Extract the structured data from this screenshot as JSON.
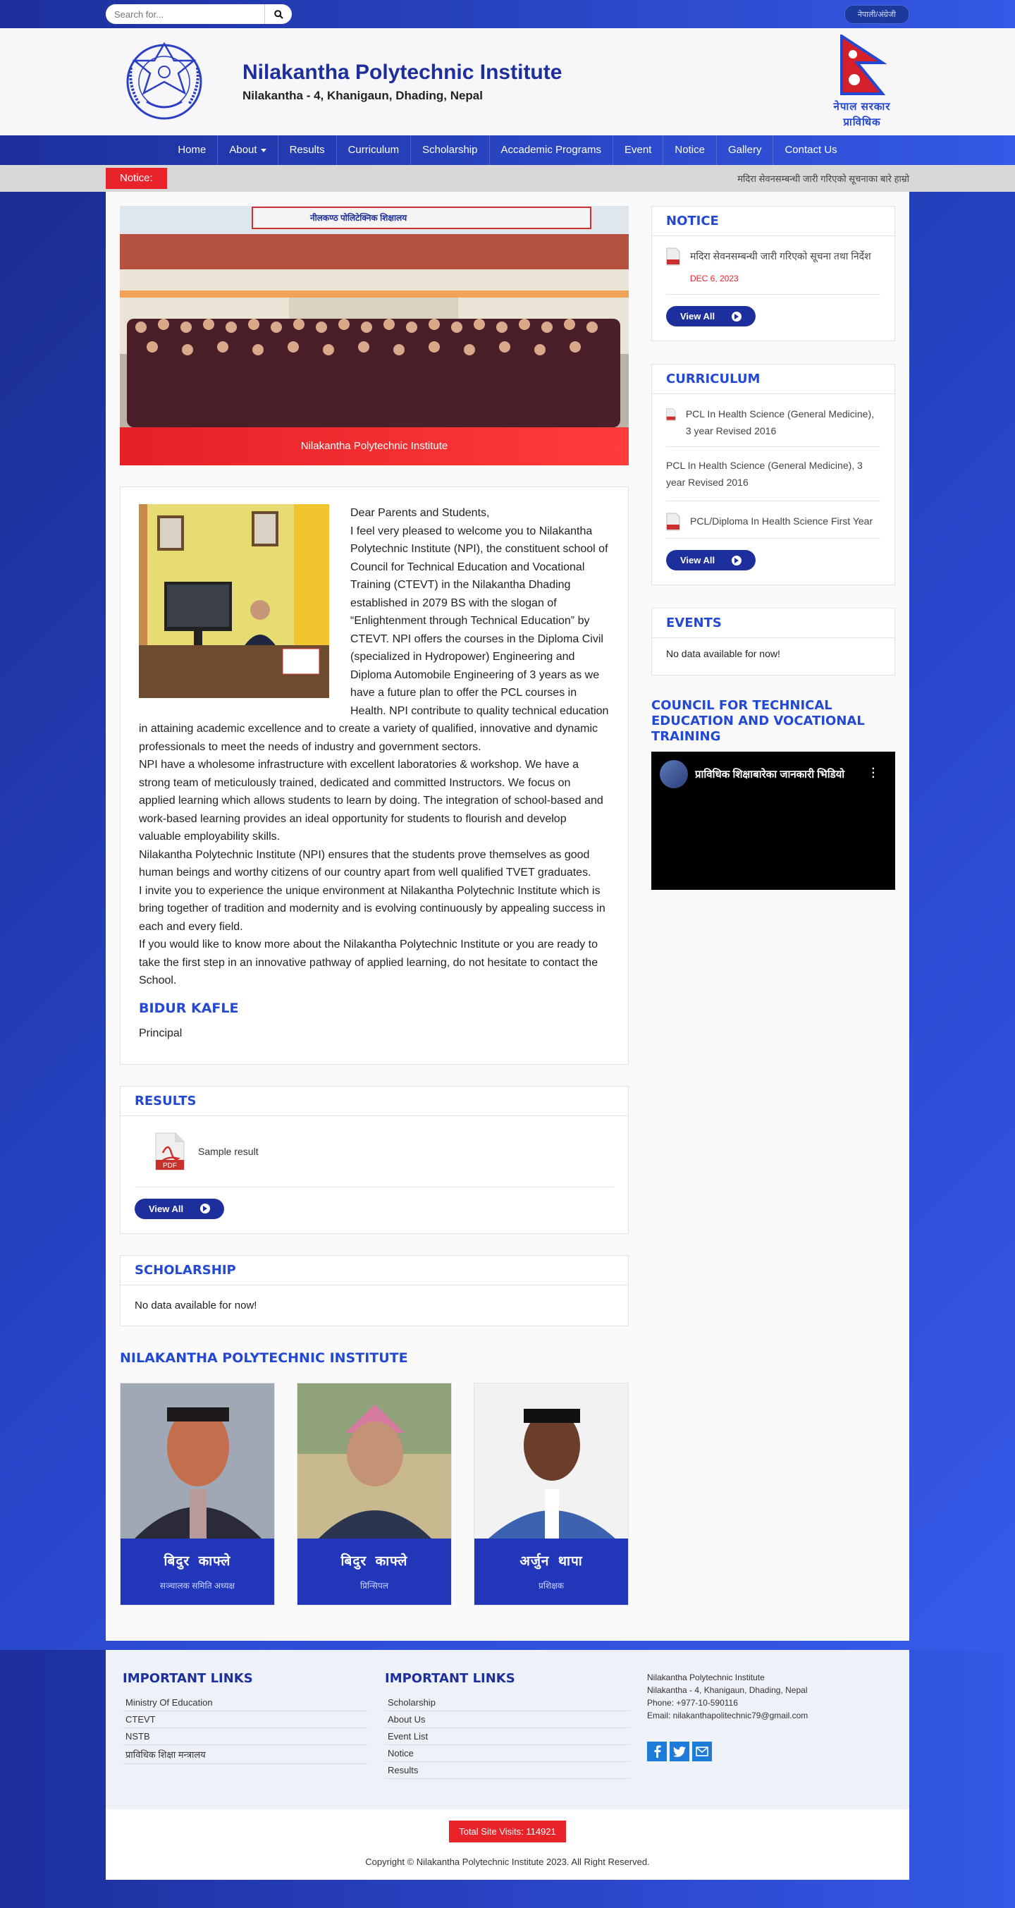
{
  "topbar": {
    "search_placeholder": "Search for...",
    "lang_label": "नेपाली/अंग्रेजी"
  },
  "header": {
    "title": "Nilakantha Polytechnic Institute",
    "subtitle": "Nilakantha - 4, Khanigaun, Dhading, Nepal",
    "flag_caption_1": "नेपाल सरकार",
    "flag_caption_2": "प्राविधिक"
  },
  "nav": {
    "items": [
      "Home",
      "About",
      "Results",
      "Curriculum",
      "Scholarship",
      "Accademic Programs",
      "Event",
      "Notice",
      "Gallery",
      "Contact Us"
    ]
  },
  "ticker": {
    "label": "Notice:",
    "text": "मदिरा सेवनसम्बन्धी जारी गरिएको सूचनाका बारे हाम्रो"
  },
  "hero": {
    "caption": "Nilakantha Polytechnic Institute",
    "sign_text": "नीलकण्ठ पोलिटेक्निक शिक्षालय"
  },
  "welcome": {
    "p1": "Dear Parents and Students,",
    "p2": "I feel very pleased to welcome you to Nilakantha Polytechnic Institute (NPI), the constituent school of Council for Technical Education and Vocational Training (CTEVT) in the Nilakantha Dhading established in 2079 BS with the slogan of “Enlightenment through Technical Education” by CTEVT. NPI offers the courses in the Diploma Civil (specialized in Hydropower) Engineering and Diploma Automobile Engineering of 3 years as we have a future plan to offer the PCL courses in Health. NPI contribute to quality technical education in attaining academic excellence and to create a variety of qualified, innovative and dynamic professionals to meet the needs of industry and government sectors.",
    "p3": "NPI have a wholesome infrastructure with excellent laboratories & workshop. We have a strong team of meticulously trained, dedicated and committed Instructors. We focus on applied learning which allows students to learn by doing. The integration of school-based and work-based learning provides an ideal opportunity for students to flourish and develop valuable employability skills.",
    "p4": "Nilakantha Polytechnic Institute (NPI) ensures that the students prove themselves as good human beings and worthy citizens of our country apart from well qualified TVET graduates.",
    "p5": "I invite you to experience the unique environment at Nilakantha Polytechnic Institute which is bring together of tradition and modernity and is evolving continuously by appealing success in each and every field.",
    "p6": "If you would like to know more about the Nilakantha Polytechnic Institute or you are ready to take the first step in an innovative pathway of applied learning, do not hesitate to contact the School.",
    "name": "BIDUR KAFLE",
    "role": "Principal"
  },
  "results": {
    "heading": "RESULTS",
    "item": "Sample result",
    "pdf_label": "PDF",
    "view_all": "View All"
  },
  "scholarship": {
    "heading": "SCHOLARSHIP",
    "empty": "No data available for now!"
  },
  "team": {
    "heading": "NILAKANTHA POLYTECHNIC INSTITUTE",
    "members": [
      {
        "name": "बिदुर काफ्ले",
        "role": "सञ्चालक समिति अध्यक्ष"
      },
      {
        "name": "बिदुर काफ्ले",
        "role": "प्रिन्सिपल"
      },
      {
        "name": "अर्जुन थापा",
        "role": "प्रशिक्षक"
      }
    ]
  },
  "notice_box": {
    "heading": "NOTICE",
    "item": "मदिरा सेवनसम्बन्धी जारी गरिएको सूचना तथा निर्देश",
    "date": "DEC 6, 2023",
    "view_all": "View All"
  },
  "curriculum_box": {
    "heading": "CURRICULUM",
    "item1": "PCL In Health Science (General Medicine), 3 year Revised 2016",
    "item2": "PCL In Health Science (General Medicine), 3 year Revised 2016",
    "item3": "PCL/Diploma In Health Science First Year",
    "view_all": "View All"
  },
  "events_box": {
    "heading": "EVENTS",
    "empty": "No data available for now!"
  },
  "ctevt": {
    "heading": "COUNCIL FOR TECHNICAL EDUCATION AND VOCATIONAL TRAINING",
    "video_title": "प्राविधिक शिक्षाबारेका जानकारी भिडियो"
  },
  "footer": {
    "col1_heading": "IMPORTANT LINKS",
    "col1_links": [
      "Ministry Of Education",
      "CTEVT",
      "NSTB",
      "प्राविधिक शिक्षा मन्त्रालय"
    ],
    "col2_heading": "IMPORTANT LINKS",
    "col2_links": [
      "Scholarship",
      "About Us",
      "Event List",
      "Notice",
      "Results"
    ],
    "org": "Nilakantha Polytechnic Institute",
    "address": "Nilakantha - 4, Khanigaun, Dhading, Nepal",
    "phone": "Phone: +977-10-590116",
    "email": "Email: nilakanthapolitechnic79@gmail.com",
    "visits": "Total Site Visits: 114921",
    "copyright": "Copyright © Nilakantha Polytechnic Institute 2023. All Right Reserved."
  },
  "colors": {
    "primary": "#1d2f9c",
    "accent": "#2348d4",
    "danger": "#e8232a"
  }
}
